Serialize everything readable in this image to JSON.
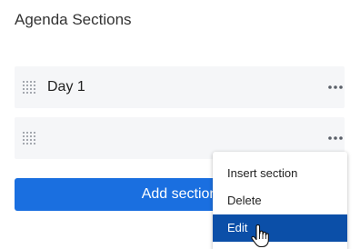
{
  "header": {
    "title": "Agenda Sections"
  },
  "sections": [
    {
      "label": "Day 1"
    },
    {
      "label": ""
    }
  ],
  "add_button": {
    "label": "Add section"
  },
  "context_menu": {
    "items": [
      {
        "label": "Insert section"
      },
      {
        "label": "Delete"
      },
      {
        "label": "Edit"
      }
    ],
    "highlighted": "Edit"
  },
  "icons": {
    "drag": "drag-handle-icon",
    "more": "more-horizontal-icon",
    "cursor": "hand-pointer-icon"
  },
  "colors": {
    "primary": "#1a6fe0",
    "menu_highlight": "#0b4fa8",
    "row_bg": "#f5f6f8"
  }
}
